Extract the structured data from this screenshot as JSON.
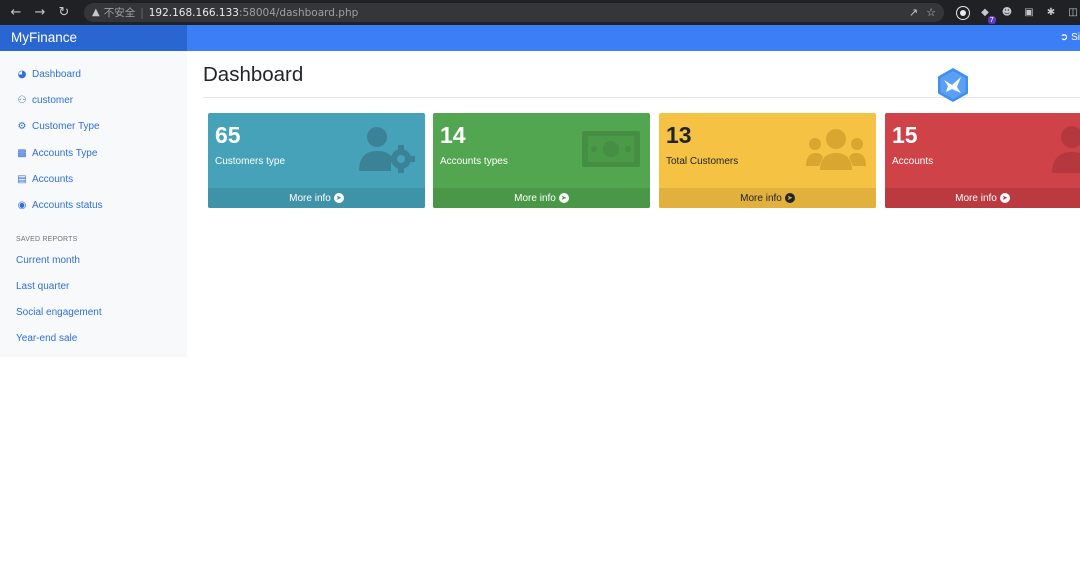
{
  "browser": {
    "security_label": "不安全",
    "url_host": "192.168.166.133",
    "url_rest": ":58004/dashboard.php",
    "extension_badge": "7",
    "icons": [
      "back-icon",
      "forward-icon",
      "reload-icon",
      "warning-icon",
      "share-icon",
      "star-icon",
      "extension-icon",
      "puzzle-icon",
      "sidepanel-icon"
    ]
  },
  "navbar": {
    "brand": "MyFinance",
    "signout_label": "Si",
    "brand_color": "#2a66d2",
    "bar_color": "#3b7ef6"
  },
  "sidebar": {
    "items": [
      {
        "label": "Dashboard",
        "icon": "tachometer-icon"
      },
      {
        "label": "customer",
        "icon": "users-icon"
      },
      {
        "label": "Customer Type",
        "icon": "users-cog-icon"
      },
      {
        "label": "Accounts Type",
        "icon": "money-bill-icon"
      },
      {
        "label": "Accounts",
        "icon": "credit-card-icon"
      },
      {
        "label": "Accounts status",
        "icon": "database-icon"
      }
    ],
    "reports_heading": "SAVED REPORTS",
    "reports": [
      "Current month",
      "Last quarter",
      "Social engagement",
      "Year-end sale"
    ]
  },
  "main": {
    "title": "Dashboard",
    "cards": [
      {
        "value": "65",
        "label": "Customers type",
        "more": "More info",
        "color": "#46a2b9",
        "icon": "user-cog-icon"
      },
      {
        "value": "14",
        "label": "Accounts types",
        "more": "More info",
        "color": "#53a650",
        "icon": "money-bill-icon"
      },
      {
        "value": "13",
        "label": "Total Customers",
        "more": "More info",
        "color": "#f5c244",
        "icon": "users-icon"
      },
      {
        "value": "15",
        "label": "Accounts",
        "more": "More info",
        "color": "#cf4248",
        "icon": "user-icon"
      }
    ]
  }
}
